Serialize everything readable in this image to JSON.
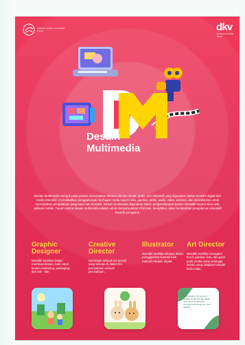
{
  "brand": {
    "left_logo_text": "Fakultas Desain Komunikasi Visual",
    "right_logo_mark": "dkv",
    "right_logo_text": "Desain Komunikasi Visual"
  },
  "hero": {
    "title_line_1": "Desain",
    "title_line_2": "Multimedia"
  },
  "intro": {
    "text": "Desain Multimedia merujuk pada proses menciptakan elemen-elemen visual, audio, dan interaktif yang digunakan dalam konteks digital dan media interaktif. Ini melibatkan penggabungan berbagai media seperti teks, gambar, grafis, audio, video, animasi, dan interaktivitas untuk menciptakan pengalaman yang kaya dan menarik. Desain multimedia digunakan dalam pengembangan konten interaktif seperti situs web, aplikasi mobile. Tujuan utama desain multimedia adalah untuk menyampaikan informasi, menghibur, atau memberikan pengalaman interaktif kepada pengguna."
  },
  "roles": [
    {
      "title_1": "Graphic",
      "title_2": "Designer",
      "desc": "Memiliki keahlian dalam membuat desain, baik untuk konten marketing, packaging, dan lain - lain"
    },
    {
      "title_1": "Creative",
      "title_2": "Director",
      "desc": "Memimpin sebuah tim kreatif yang bekerja di dalam fim perusahaan sebuah perusahaan."
    },
    {
      "title_1": "Illustrator",
      "title_2": "",
      "desc": "Memiliki keahlian khusus dalam menggambar ilustrasi baik manual maupun digital."
    },
    {
      "title_1": "Art Director",
      "title_2": "",
      "desc": "Memiliki keahlian mengatur huruf, gambar, foto, dan garis pada media cetak sehingga desain yang disajikan tampak lebih indah."
    }
  ],
  "thumb3": {
    "text": "Pembelajaran Kompetensi Hafalan Surah Menggunakan Video Animasi Berbasis Pengetahuan Mengenai Huruf Hijaiyah"
  }
}
